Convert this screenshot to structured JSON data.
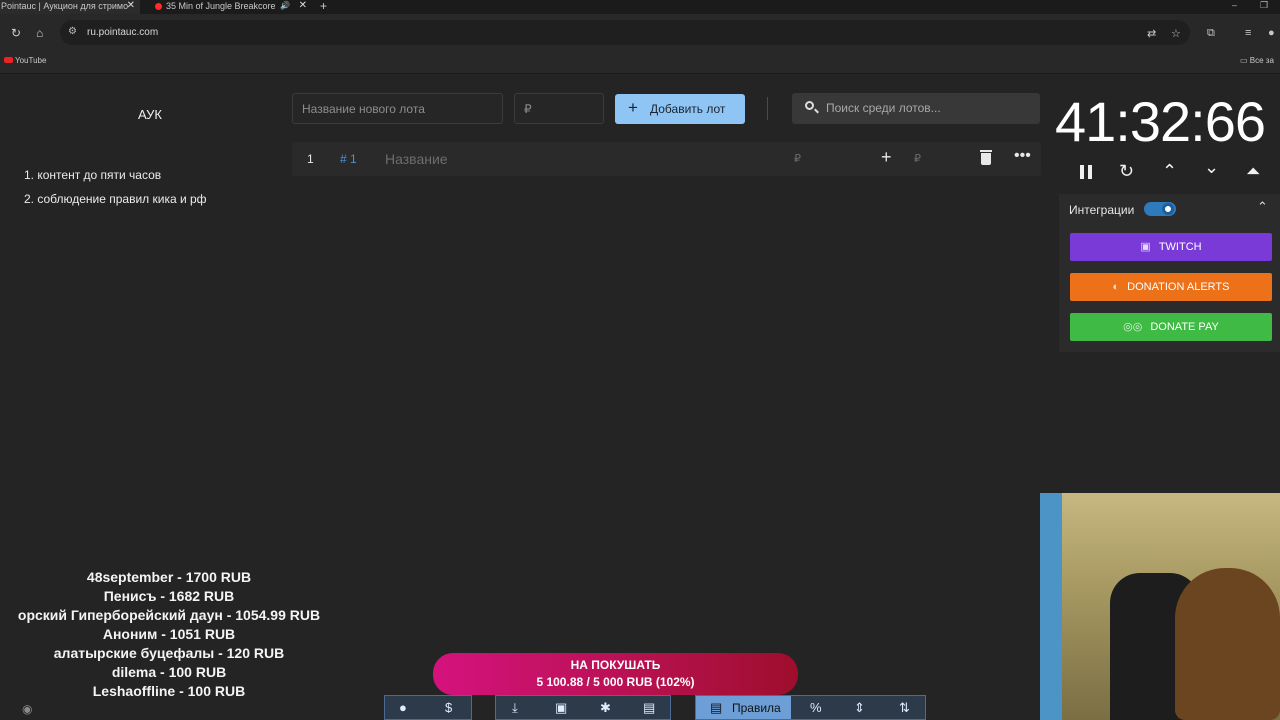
{
  "browser": {
    "tabs": [
      {
        "title": "Pointauc | Аукцион для стримо"
      },
      {
        "title": "35 Min of Jungle Breakcore"
      }
    ],
    "url": "ru.pointauc.com",
    "bookmarks": [
      "YouTube",
      "Все за"
    ]
  },
  "left_panel": {
    "title": "АУК",
    "rules": [
      "1. контент до пяти часов",
      "2. соблюдение правил кика и рф"
    ]
  },
  "add_form": {
    "name_placeholder": "Название нового лота",
    "price_placeholder": "₽",
    "add_button": "Добавить лот",
    "search_placeholder": "Поиск среди лотов..."
  },
  "lots": [
    {
      "index": "1",
      "id": "# 1",
      "name_placeholder": "Название",
      "amount_placeholder": "₽",
      "add_amount_placeholder": "₽"
    }
  ],
  "timer": {
    "value": "41:32:66"
  },
  "integrations": {
    "label": "Интеграции",
    "enabled": true,
    "services": [
      {
        "name": "TWITCH",
        "icon": "twitch-icon",
        "color": "#7a3ad8"
      },
      {
        "name": "DONATION ALERTS",
        "icon": "donationalerts-icon",
        "color": "#ec7118"
      },
      {
        "name": "DONATE PAY",
        "icon": "donatepay-icon",
        "color": "#3fba45"
      }
    ]
  },
  "donors": [
    "48september - 1700 RUB",
    "Пенисъ - 1682 RUB",
    "орский Гиперборейский даун - 1054.99 RUB",
    "Аноним - 1051 RUB",
    "алатырские буцефалы - 120 RUB",
    "dilema - 100 RUB",
    "Leshaoffline - 100 RUB"
  ],
  "goal": {
    "title": "НА ПОКУШАТЬ",
    "progress": "5 100.88 / 5 000 RUB (102%)"
  },
  "toolbar": {
    "rules_label": "Правила",
    "icons": [
      "github-icon",
      "dollar-icon",
      "download-icon",
      "save-icon",
      "bug-icon",
      "import-icon",
      "rules-icon",
      "percent-icon",
      "split-icon",
      "sort-icon"
    ]
  }
}
